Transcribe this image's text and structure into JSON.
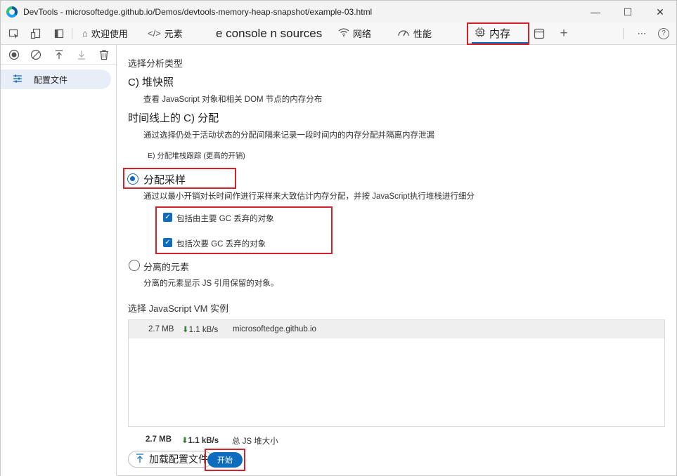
{
  "window": {
    "title": "DevTools - microsoftedge.github.io/Demos/devtools-memory-heap-snapshot/example-03.html",
    "controls": {
      "minimize": "—",
      "maximize": "☐",
      "close": "✕"
    }
  },
  "toolbar": {
    "tabs": [
      {
        "label": "欢迎使用",
        "icon": "home-icon"
      },
      {
        "label": "元素",
        "icon": "code-icon"
      },
      {
        "label": "e console n sources",
        "icon": ""
      },
      {
        "label": "网络",
        "icon": "wifi-icon"
      },
      {
        "label": "性能",
        "icon": "gauge-icon"
      },
      {
        "label": "内存",
        "icon": "chip-icon",
        "active": true
      }
    ],
    "more": "⋯",
    "help": "?"
  },
  "sidebar": {
    "items": [
      {
        "label": "配置文件",
        "icon": "sliders-icon"
      }
    ]
  },
  "profiles": {
    "section_title": "选择分析类型",
    "heap_snapshot": {
      "title": "C) 堆快照",
      "desc": "查看 JavaScript 对象和相关 DOM 节点的内存分布"
    },
    "timeline": {
      "title": "时间线上的 C) 分配",
      "desc": "通过选择仍处于活动状态的分配间隔来记录一段时间内的内存分配并隔离内存泄漏",
      "sub_option": "E)  分配堆栈跟踪 (更高的开销)"
    },
    "sampling": {
      "title": "分配采样",
      "desc": "通过以最小开销对长时间作进行采样来大致估计内存分配，并按 JavaScript执行堆栈进行细分",
      "checkbox1": "包括由主要 GC 丢弃的对象",
      "checkbox2": "包括次要 GC 丢弃的对象",
      "selected": true
    },
    "detached": {
      "title": "分离的元素",
      "desc": "分离的元素显示 JS 引用保留的对象。"
    }
  },
  "vm": {
    "section_title": "选择 JavaScript VM 实例",
    "instances": [
      {
        "size": "2.7 MB",
        "rate_arrow": "⬇",
        "rate": "1.1 kB/s",
        "url": "microsoftedge.github.io"
      }
    ],
    "total": {
      "size": "2.7 MB",
      "rate_arrow": "⬇",
      "rate": "1.1 kB/s",
      "label": "总 JS 堆大小"
    }
  },
  "actions": {
    "load_label": "加载配置文件",
    "start_label": "开始"
  },
  "colors": {
    "accent": "#0f6cbd",
    "highlight": "#d3222a"
  }
}
